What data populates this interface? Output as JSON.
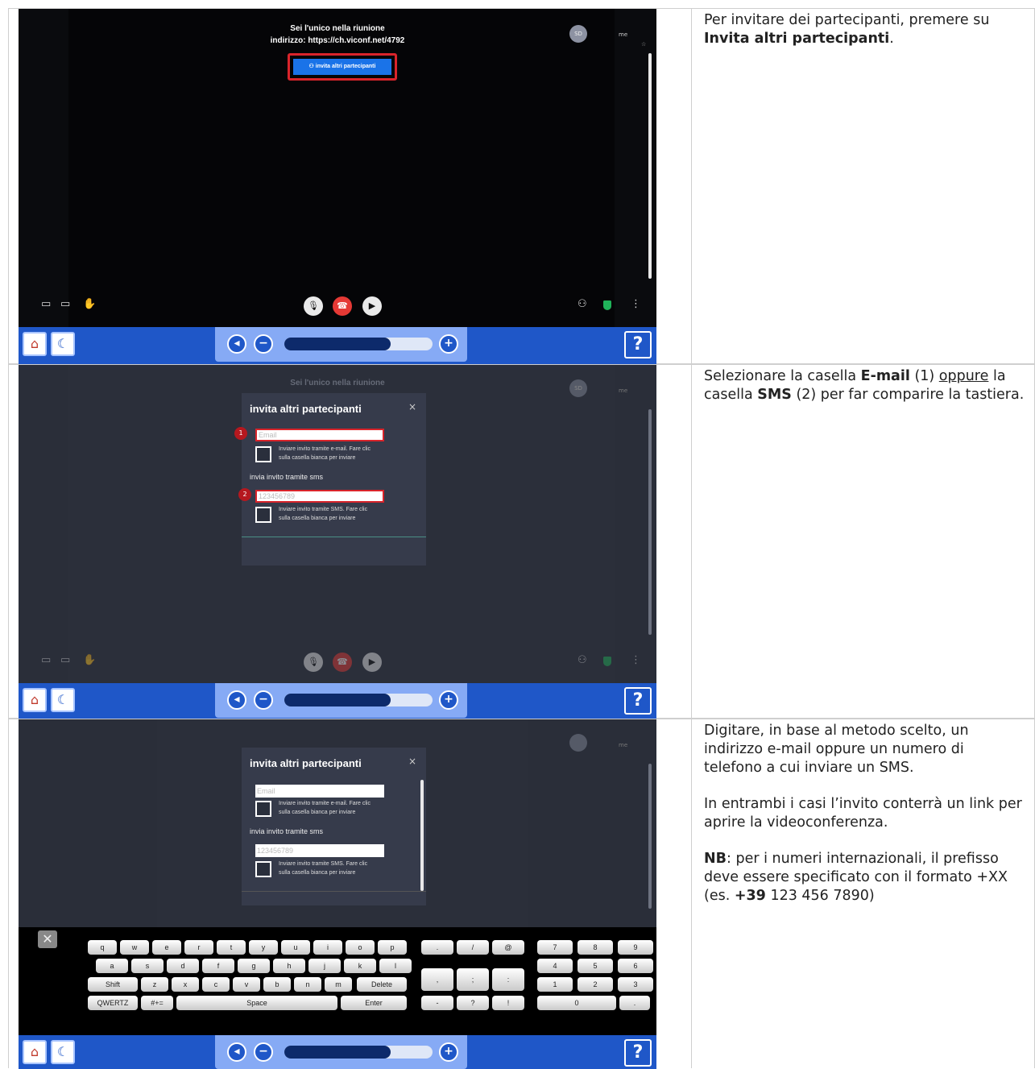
{
  "rows": [
    {
      "screen": {
        "meeting_line1": "Sei l'unico nella riunione",
        "meeting_line2": "indirizzo: https://ch.viconf.net/4792",
        "invite_button": "invita altri partecipanti",
        "avatar": "SD",
        "me_label": "me"
      },
      "text": {
        "p1_a": "Per invitare dei partecipanti, premere su ",
        "p1_bold": "Invita altri partecipanti",
        "p1_end": "."
      }
    },
    {
      "screen": {
        "meeting_line1": "Sei l'unico nella riunione",
        "avatar": "SD",
        "me_label": "me",
        "dialog_title": "invita altri partecipanti",
        "close": "×",
        "email_placeholder": "Email",
        "email_hint_1": "Inviare invito tramite e-mail. Fare clic",
        "email_hint_2": "sulla casella bianca per inviare",
        "sms_label": "invia invito tramite sms",
        "sms_placeholder": "123456789",
        "sms_hint_1": "Inviare invito tramite SMS. Fare clic",
        "sms_hint_2": "sulla casella bianca per inviare",
        "badge1": "1",
        "badge2": "2"
      },
      "text": {
        "a": "Selezionare la casella ",
        "b1": "E-mail",
        "c": " (1) ",
        "u": "oppure",
        "d": " la casella ",
        "b2": "SMS",
        "e": " (2) per far comparire la tastiera."
      }
    },
    {
      "screen": {
        "avatar": "",
        "me_label": "me",
        "dialog_title": "invita altri partecipanti",
        "close": "×",
        "email_placeholder": "Email",
        "email_hint_1": "Inviare invito tramite e-mail. Fare clic",
        "email_hint_2": "sulla casella bianca per inviare",
        "sms_label": "invia invito tramite sms",
        "sms_placeholder": "123456789",
        "sms_hint_1": "Inviare invito tramite SMS. Fare clic",
        "sms_hint_2": "sulla casella bianca per inviare",
        "keyboard": {
          "row1": [
            "q",
            "w",
            "e",
            "r",
            "t",
            "y",
            "u",
            "i",
            "o",
            "p"
          ],
          "row2": [
            "a",
            "s",
            "d",
            "f",
            "g",
            "h",
            "j",
            "k",
            "l"
          ],
          "row3_shift": "Shift",
          "row3": [
            "z",
            "x",
            "c",
            "v",
            "b",
            "n",
            "m"
          ],
          "row3_delete": "Delete",
          "row4_layout": "QWERTZ",
          "row4_sym": "#+=",
          "row4_space": "Space",
          "row4_enter": "Enter",
          "sym1": [
            ".",
            "/",
            "@"
          ],
          "sym2": [
            ",",
            ";",
            ":"
          ],
          "sym3": [
            "-",
            "?",
            "!"
          ],
          "num1": [
            "7",
            "8",
            "9"
          ],
          "num2": [
            "4",
            "5",
            "6"
          ],
          "num3": [
            "1",
            "2",
            "3"
          ],
          "num4_zero": "0",
          "num4_dot": "."
        }
      },
      "text": {
        "p1": "Digitare, in base al metodo scelto, un indirizzo e-mail oppure un numero di telefono a cui inviare un SMS.",
        "p2": "In entrambi i casi l’invito conterrà un link per aprire la videoconferenza.",
        "p3_bold": "NB",
        "p3_a": ": per i numeri internazionali, il prefisso deve essere specificato con il formato +XX (es. ",
        "p3_bold2": "+39",
        "p3_b": " 123 456 7890)"
      }
    }
  ],
  "taskbar": {
    "help": "?",
    "vol_minus": "−",
    "vol_plus": "+",
    "volume_level": 0.72
  }
}
